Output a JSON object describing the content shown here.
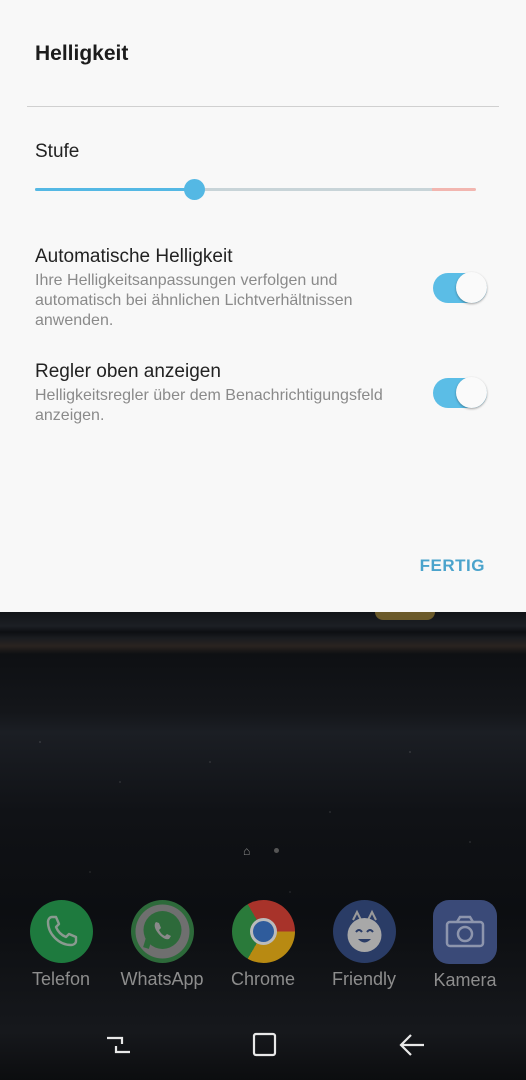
{
  "panel": {
    "title": "Helligkeit",
    "level_label": "Stufe",
    "slider_value": 0.36,
    "settings": [
      {
        "title": "Automatische Helligkeit",
        "description": "Ihre Helligkeitsanpassungen verfolgen und automatisch bei ähnlichen Lichtverhältnissen anwenden.",
        "enabled": true
      },
      {
        "title": "Regler oben anzeigen",
        "description": "Helligkeitsregler über dem Benachrichtigungsfeld anzeigen.",
        "enabled": true
      }
    ],
    "done_label": "FERTIG"
  },
  "dock": {
    "apps": [
      {
        "label": "Telefon",
        "icon": "phone-icon"
      },
      {
        "label": "WhatsApp",
        "icon": "whatsapp-icon"
      },
      {
        "label": "Chrome",
        "icon": "chrome-icon"
      },
      {
        "label": "Friendly",
        "icon": "friendly-icon"
      },
      {
        "label": "Kamera",
        "icon": "camera-icon"
      }
    ]
  },
  "navbar": {
    "items": [
      "recent-apps-icon",
      "home-icon",
      "back-icon"
    ]
  },
  "colors": {
    "accent": "#54b8e4",
    "done": "#4aa3cc",
    "slider_track": "#c8d4d8",
    "slider_warning": "#f2b6b0",
    "toggle_on": "#5bbde6"
  }
}
